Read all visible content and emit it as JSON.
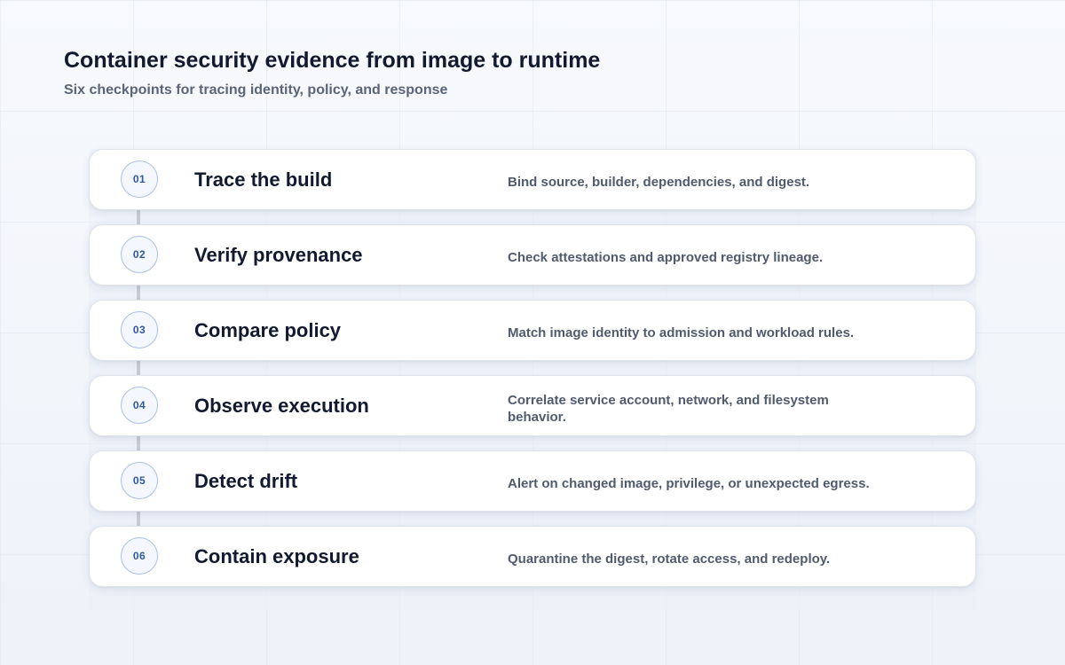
{
  "header": {
    "title": "Container security evidence from image to runtime",
    "subtitle": "Six checkpoints for tracing identity, policy, and response"
  },
  "steps": [
    {
      "number": "01",
      "title": "Trace the build",
      "description": "Bind source, builder, dependencies, and digest."
    },
    {
      "number": "02",
      "title": "Verify provenance",
      "description": "Check attestations and approved registry lineage."
    },
    {
      "number": "03",
      "title": "Compare policy",
      "description": "Match image identity to admission and workload rules."
    },
    {
      "number": "04",
      "title": "Observe execution",
      "description": "Correlate service account, network, and filesystem behavior."
    },
    {
      "number": "05",
      "title": "Detect drift",
      "description": "Alert on changed image, privilege, or unexpected egress."
    },
    {
      "number": "06",
      "title": "Contain exposure",
      "description": "Quarantine the digest, rotate access, and redeploy."
    }
  ],
  "colors": {
    "accent": "#2f5a9e",
    "title_text": "#111a2e",
    "muted_text": "#505b6d",
    "connector": "#c6cbd3"
  }
}
